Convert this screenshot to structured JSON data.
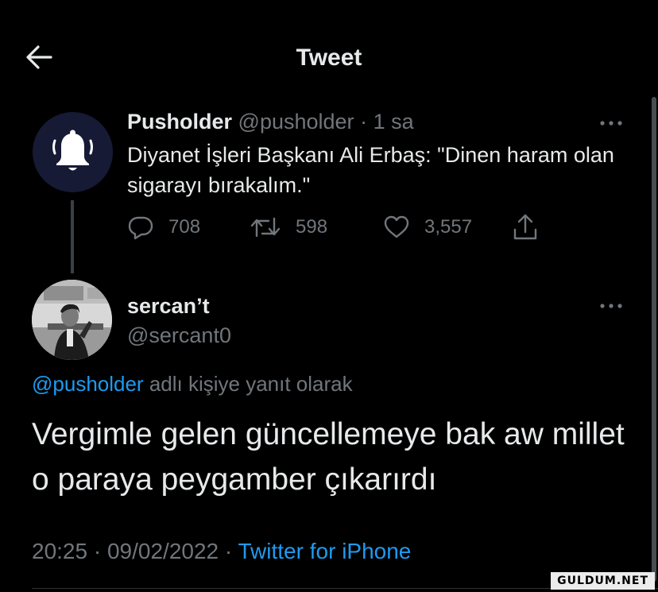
{
  "header": {
    "title": "Tweet",
    "back_icon": "arrow-left-icon"
  },
  "parent_tweet": {
    "avatar_icon": "bell-icon",
    "name": "Pusholder",
    "handle": "@pusholder",
    "separator": "·",
    "time": "1 sa",
    "text": "Diyanet İşleri Başkanı Ali Erbaş: \"Dinen haram olan sigarayı bırakalım.\"",
    "replies": "708",
    "retweets": "598",
    "likes": "3,557"
  },
  "reply_tweet": {
    "name": "sercan’t",
    "handle": "@sercant0",
    "replying_mention": "@pusholder",
    "replying_suffix": "adlı kişiye yanıt olarak",
    "text": "Vergimle gelen güncellemeye bak aw millet o paraya peygamber çıkarırdı",
    "time": "20:25",
    "meta_separator_1": "·",
    "date": "09/02/2022",
    "meta_separator_2": "·",
    "source": "Twitter for iPhone"
  },
  "watermark": "GULDUM.NET",
  "colors": {
    "background": "#000000",
    "text": "#e7e9ea",
    "muted": "#71767b",
    "accent": "#1d9bf0",
    "bell_avatar_bg": "#161a35"
  }
}
